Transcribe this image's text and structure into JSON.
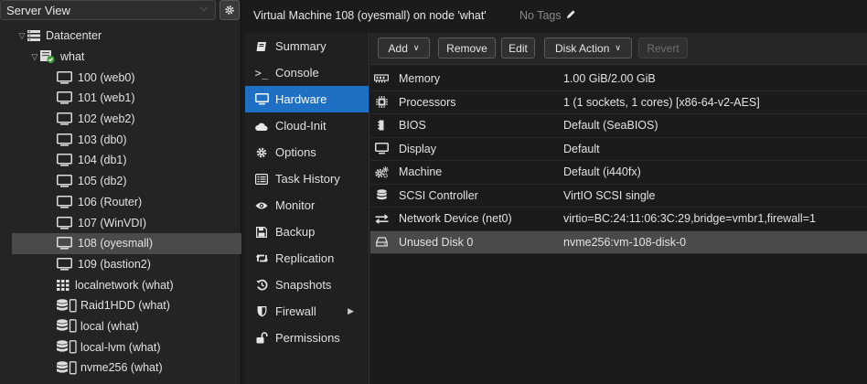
{
  "left_panel": {
    "view_select": "Server View",
    "tree": [
      {
        "label": "Datacenter",
        "icon": "datacenter-icon",
        "level": 0,
        "expand": "▽"
      },
      {
        "label": "what",
        "icon": "node-icon",
        "level": 1,
        "expand": "▽"
      },
      {
        "label": "100 (web0)",
        "icon": "vm-icon",
        "level": 2
      },
      {
        "label": "101 (web1)",
        "icon": "vm-icon",
        "level": 2
      },
      {
        "label": "102 (web2)",
        "icon": "vm-icon",
        "level": 2
      },
      {
        "label": "103 (db0)",
        "icon": "vm-icon",
        "level": 2
      },
      {
        "label": "104 (db1)",
        "icon": "vm-icon",
        "level": 2
      },
      {
        "label": "105 (db2)",
        "icon": "vm-icon",
        "level": 2
      },
      {
        "label": "106 (Router)",
        "icon": "vm-icon",
        "level": 2
      },
      {
        "label": "107 (WinVDI)",
        "icon": "vm-icon",
        "level": 2
      },
      {
        "label": "108 (oyesmall)",
        "icon": "vm-icon",
        "level": 2,
        "selected": true
      },
      {
        "label": "109 (bastion2)",
        "icon": "vm-icon",
        "level": 2
      },
      {
        "label": "localnetwork (what)",
        "icon": "network-grid-icon",
        "level": 2
      },
      {
        "label": "Raid1HDD (what)",
        "icon": "storage-icon",
        "level": 2
      },
      {
        "label": "local (what)",
        "icon": "storage-icon",
        "level": 2
      },
      {
        "label": "local-lvm (what)",
        "icon": "storage-icon",
        "level": 2
      },
      {
        "label": "nvme256 (what)",
        "icon": "storage-icon",
        "level": 2
      }
    ]
  },
  "header": {
    "title": "Virtual Machine 108 (oyesmall) on node 'what'",
    "tags": "No Tags"
  },
  "vm_nav": [
    {
      "label": "Summary",
      "icon": "summary-book-icon"
    },
    {
      "label": "Console",
      "icon": "console-prompt-icon"
    },
    {
      "label": "Hardware",
      "icon": "monitor-icon",
      "selected": true
    },
    {
      "label": "Cloud-Init",
      "icon": "cloud-icon"
    },
    {
      "label": "Options",
      "icon": "gear-icon"
    },
    {
      "label": "Task History",
      "icon": "list-icon"
    },
    {
      "label": "Monitor",
      "icon": "eye-icon"
    },
    {
      "label": "Backup",
      "icon": "floppy-icon"
    },
    {
      "label": "Replication",
      "icon": "retweet-icon"
    },
    {
      "label": "Snapshots",
      "icon": "history-icon"
    },
    {
      "label": "Firewall",
      "icon": "shield-icon",
      "has_submenu": true
    },
    {
      "label": "Permissions",
      "icon": "unlock-icon"
    }
  ],
  "toolbar": {
    "add": "Add",
    "remove": "Remove",
    "edit": "Edit",
    "disk_action": "Disk Action",
    "revert": "Revert"
  },
  "hardware": [
    {
      "name": "Memory",
      "value": "1.00 GiB/2.00 GiB",
      "icon": "memory-icon"
    },
    {
      "name": "Processors",
      "value": "1 (1 sockets, 1 cores) [x86-64-v2-AES]",
      "icon": "cpu-icon"
    },
    {
      "name": "BIOS",
      "value": "Default (SeaBIOS)",
      "icon": "bios-chip-icon"
    },
    {
      "name": "Display",
      "value": "Default",
      "icon": "display-icon"
    },
    {
      "name": "Machine",
      "value": "Default (i440fx)",
      "icon": "cogs-icon"
    },
    {
      "name": "SCSI Controller",
      "value": "VirtIO SCSI single",
      "icon": "database-icon"
    },
    {
      "name": "Network Device (net0)",
      "value": "virtio=BC:24:11:06:3C:29,bridge=vmbr1,firewall=1",
      "icon": "exchange-icon"
    },
    {
      "name": "Unused Disk 0",
      "value": "nvme256:vm-108-disk-0",
      "icon": "hdd-icon",
      "selected": true
    }
  ],
  "colors": {
    "accent": "#1f6fc4",
    "selection": "#4a4a4a",
    "background": "#1b1b1b",
    "panel": "#242424"
  }
}
